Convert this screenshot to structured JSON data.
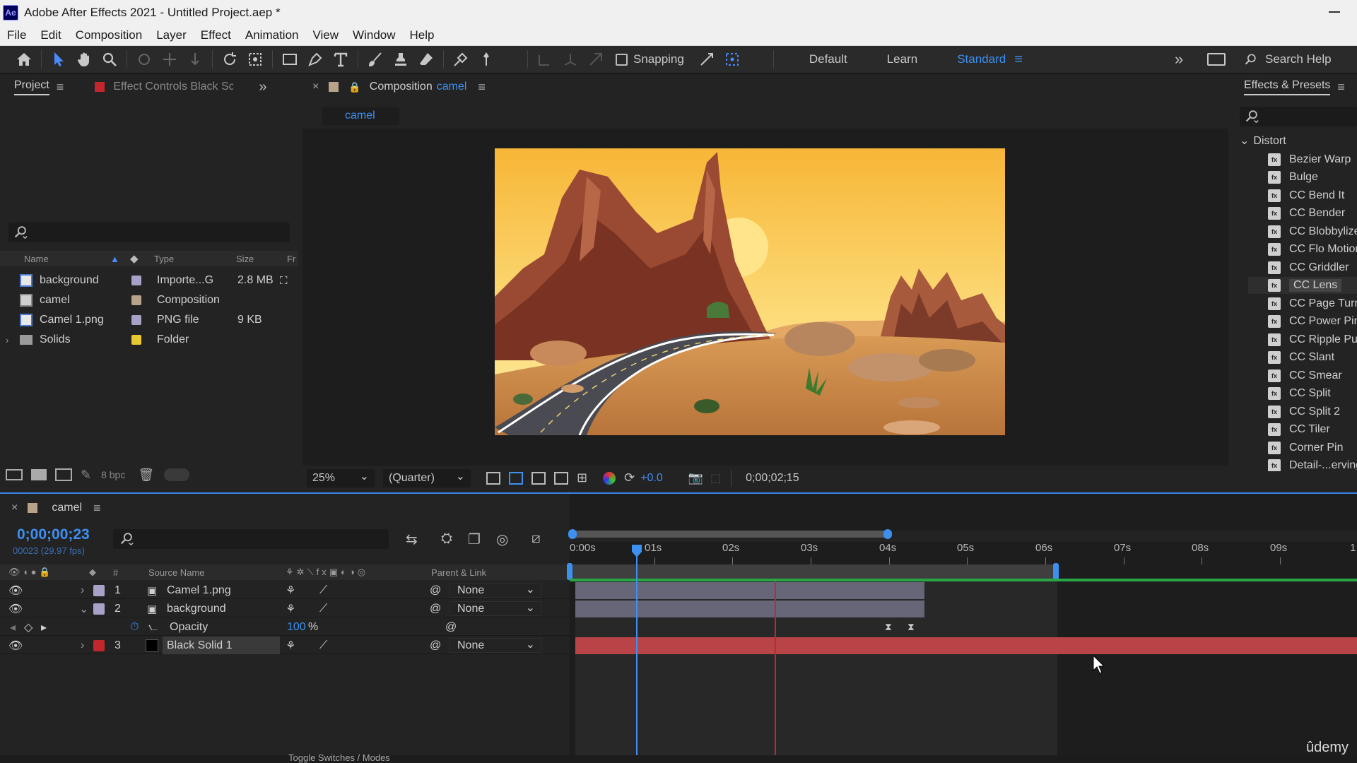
{
  "titlebar": {
    "logo": "Ae",
    "title": "Adobe After Effects 2021 - Untitled Project.aep *"
  },
  "menu": [
    "File",
    "Edit",
    "Composition",
    "Layer",
    "Effect",
    "Animation",
    "View",
    "Window",
    "Help"
  ],
  "toolbar": {
    "snapping_label": "Snapping",
    "workspaces": [
      "Default",
      "Learn",
      "Standard"
    ],
    "active_workspace": "Standard",
    "search_help": "Search Help"
  },
  "project": {
    "tab_label": "Project",
    "effect_controls_label": "Effect Controls Black Sc",
    "columns": {
      "name": "Name",
      "type": "Type",
      "size": "Size",
      "fr": "Fr"
    },
    "items": [
      {
        "name": "background",
        "type": "Importe...G",
        "size": "2.8 MB",
        "swatch": "#a8a2c8"
      },
      {
        "name": "camel",
        "type": "Composition",
        "size": "",
        "swatch": "#b8a28a"
      },
      {
        "name": "Camel 1.png",
        "type": "PNG file",
        "size": "9 KB",
        "swatch": "#a8a2c8"
      },
      {
        "name": "Solids",
        "type": "Folder",
        "size": "",
        "swatch": "#e8c830"
      }
    ],
    "bpc": "8 bpc"
  },
  "composition": {
    "tab_prefix": "Composition",
    "tab_name": "camel",
    "sub_tab": "camel",
    "zoom": "25%",
    "resolution": "(Quarter)",
    "exposure": "+0.0",
    "timecode": "0;00;02;15"
  },
  "effects": {
    "tab_label": "Effects & Presets",
    "category": "Distort",
    "items": [
      "Bezier Warp",
      "Bulge",
      "CC Bend It",
      "CC Bender",
      "CC Blobbylize",
      "CC Flo Motion",
      "CC Griddler",
      "CC Lens",
      "CC Page Turn",
      "CC Power Pin",
      "CC Ripple Pulse",
      "CC Slant",
      "CC Smear",
      "CC Split",
      "CC Split 2",
      "CC Tiler",
      "Corner Pin",
      "Detail-...erving"
    ],
    "selected": "CC Lens"
  },
  "timeline": {
    "tab_name": "camel",
    "timecode": "0;00;00;23",
    "fps": "00023 (29.97 fps)",
    "col_hash": "#",
    "col_source_name": "Source Name",
    "col_parent": "Parent & Link",
    "ruler_labels": [
      "0:00s",
      "01s",
      "02s",
      "03s",
      "04s",
      "05s",
      "06s",
      "07s",
      "08s",
      "09s",
      "1"
    ],
    "layers": [
      {
        "num": "1",
        "name": "Camel 1.png",
        "swatch": "#a8a2c8",
        "parent": "None"
      },
      {
        "num": "2",
        "name": "background",
        "swatch": "#a8a2c8",
        "parent": "None"
      },
      {
        "num": "3",
        "name": "Black Solid 1",
        "swatch": "#c1272d",
        "parent": "None"
      }
    ],
    "opacity_label": "Opacity",
    "opacity_value": "100",
    "opacity_unit": "%",
    "toggle_label": "Toggle Switches / Modes"
  },
  "watermark": "ûdemy"
}
